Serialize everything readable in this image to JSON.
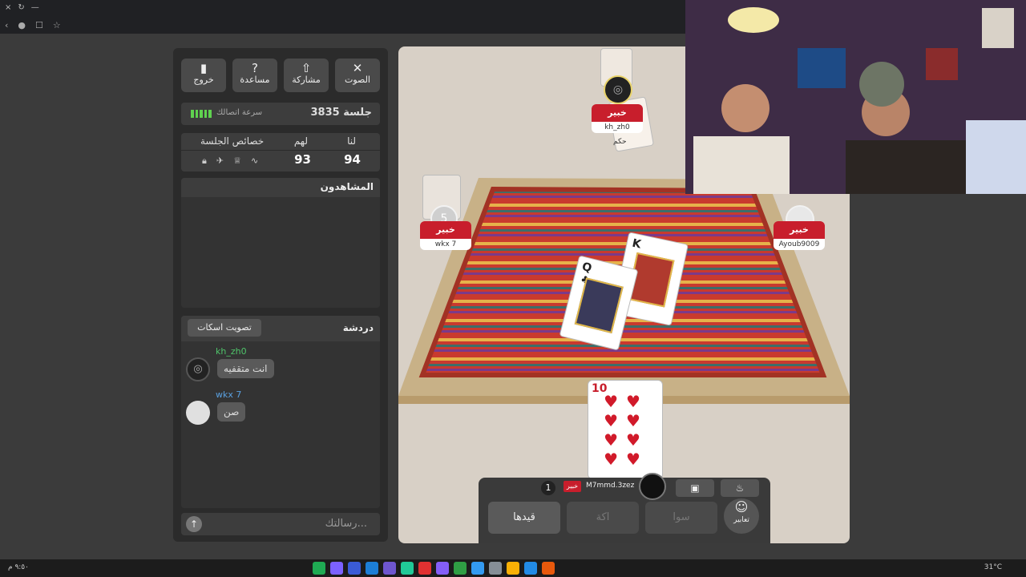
{
  "browser": {
    "close": "×",
    "reload": "↻",
    "minimize": "—"
  },
  "panel": {
    "buttons": [
      {
        "label": "خروج",
        "icon": "exit-icon",
        "glyph": "▮"
      },
      {
        "label": "مساعدة",
        "icon": "help-icon",
        "glyph": "?"
      },
      {
        "label": "مشاركة",
        "icon": "share-icon",
        "glyph": "⇧"
      },
      {
        "label": "الصوت",
        "icon": "sound-off-icon",
        "glyph": "✕"
      }
    ],
    "session_label": "جلسة 3835",
    "connection_label": "سرعة اتصالك",
    "props_label": "خصائص الجلسة",
    "them_label": "لهم",
    "us_label": "لنا",
    "them_score": "93",
    "us_score": "94",
    "viewers_title": "المشاهدون",
    "chat_title": "دردشة",
    "mute_vote_label": "تصويت اسكات",
    "messages": [
      {
        "user": "kh_zh0",
        "text": "انت متقفيه",
        "color": "#4fc46a"
      },
      {
        "user": "wkx 7",
        "text": "صن",
        "color": "#5aa0e0"
      }
    ],
    "input_placeholder": "رسالتك..."
  },
  "game": {
    "top_player": {
      "name": "kh_zh0",
      "status": "خبير",
      "sub": "حكم"
    },
    "left_player": {
      "name": "wkx 7",
      "status": "خبير",
      "count": "5"
    },
    "right_player": {
      "name": "Ayoub9009",
      "status": "خبير"
    },
    "self_player": {
      "name": "M7mmd.3zez",
      "status": "خبير",
      "count": "1"
    },
    "center_cards": [
      "Q",
      "K"
    ],
    "hand_card": {
      "rank": "10",
      "suit": "♥"
    },
    "actions": {
      "qaydha": "قيدها",
      "akka": "اكة",
      "sawa": "سوا",
      "expressions": "تعابير"
    },
    "small_buttons": {
      "gift": "gift-icon",
      "fire": "fire-icon"
    }
  },
  "taskbar": {
    "weather": "31°C",
    "time": "٩:٥٠ م"
  }
}
